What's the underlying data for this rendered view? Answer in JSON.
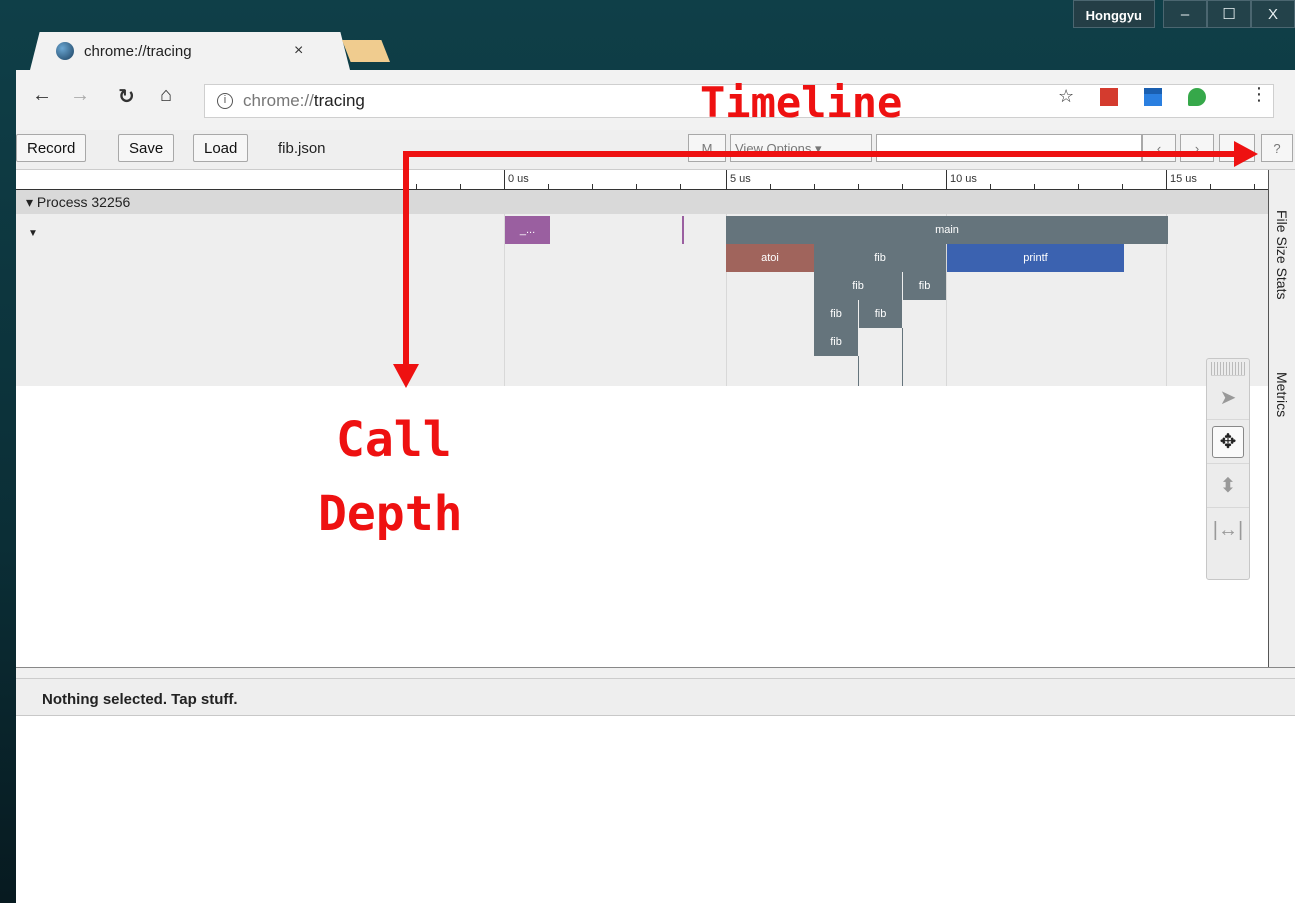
{
  "window": {
    "user": "Honggyu",
    "controls": [
      "–",
      "☐",
      "X"
    ]
  },
  "tab": {
    "title": "chrome://tracing",
    "close": "×"
  },
  "omnibox": {
    "scheme": "chrome://",
    "host": "tracing"
  },
  "tracing_toolbar": {
    "record": "Record",
    "save": "Save",
    "load": "Load",
    "file": "fib.json",
    "m_button": "M",
    "view_options": "View Options ▾",
    "nav_prev": "‹",
    "nav_next": "›",
    "help": "?"
  },
  "ruler": {
    "ticks": [
      "0 us",
      "5 us",
      "10 us",
      "15 us"
    ]
  },
  "process": {
    "label": "Process 32256"
  },
  "slices": [
    {
      "name": "_..."
    },
    {
      "name": "main"
    },
    {
      "name": "atoi"
    },
    {
      "name": "fib"
    },
    {
      "name": "printf"
    },
    {
      "name": "fib"
    },
    {
      "name": "fib"
    },
    {
      "name": "fib"
    },
    {
      "name": "fib"
    },
    {
      "name": "fib"
    }
  ],
  "side_panel": {
    "file_size_stats": "File Size Stats",
    "metrics": "Metrics"
  },
  "analysis": {
    "message": "Nothing selected. Tap stuff."
  },
  "annotations": {
    "timeline": "Timeline",
    "call": "Call",
    "depth": "Depth"
  },
  "colors": {
    "main": "#65747c",
    "atoi": "#a0645c",
    "printf": "#3b62b0",
    "underscore": "#9a5fa0",
    "annotation": "#ee1111"
  }
}
